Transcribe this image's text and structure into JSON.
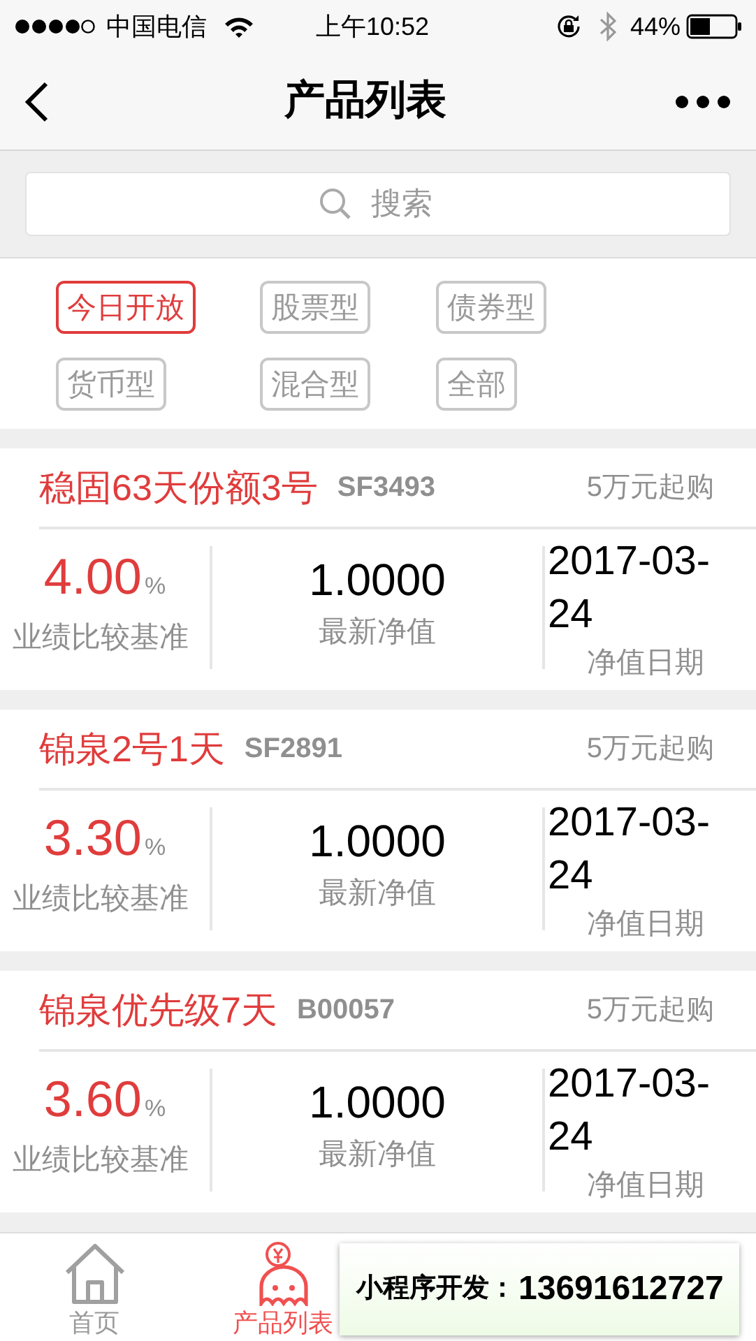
{
  "status_bar": {
    "carrier": "中国电信",
    "time": "上午10:52",
    "battery": "44%"
  },
  "nav": {
    "title": "产品列表"
  },
  "search": {
    "placeholder": "搜索"
  },
  "filters": [
    {
      "label": "今日开放",
      "selected": true
    },
    {
      "label": "股票型",
      "selected": false
    },
    {
      "label": "债券型",
      "selected": false
    },
    {
      "label": "货币型",
      "selected": false
    },
    {
      "label": "混合型",
      "selected": false
    },
    {
      "label": "全部",
      "selected": false
    }
  ],
  "products": [
    {
      "name": "稳固63天份额3号",
      "code": "SF3493",
      "min_purchase": "5万元起购",
      "rate": "4.00",
      "rate_unit": "%",
      "rate_label": "业绩比较基准",
      "nav_value": "1.0000",
      "nav_label": "最新净值",
      "nav_date": "2017-03-24",
      "date_label": "净值日期"
    },
    {
      "name": "锦泉2号1天",
      "code": "SF2891",
      "min_purchase": "5万元起购",
      "rate": "3.30",
      "rate_unit": "%",
      "rate_label": "业绩比较基准",
      "nav_value": "1.0000",
      "nav_label": "最新净值",
      "nav_date": "2017-03-24",
      "date_label": "净值日期"
    },
    {
      "name": "锦泉优先级7天",
      "code": "B00057",
      "min_purchase": "5万元起购",
      "rate": "3.60",
      "rate_unit": "%",
      "rate_label": "业绩比较基准",
      "nav_value": "1.0000",
      "nav_label": "最新净值",
      "nav_date": "2017-03-24",
      "date_label": "净值日期"
    }
  ],
  "tab_bar": [
    {
      "kind": "home",
      "label": "首页",
      "selected": false
    },
    {
      "kind": "products",
      "label": "产品列表",
      "selected": true
    }
  ],
  "overlay": {
    "label": "小程序开发：",
    "phone": "13691612727"
  }
}
